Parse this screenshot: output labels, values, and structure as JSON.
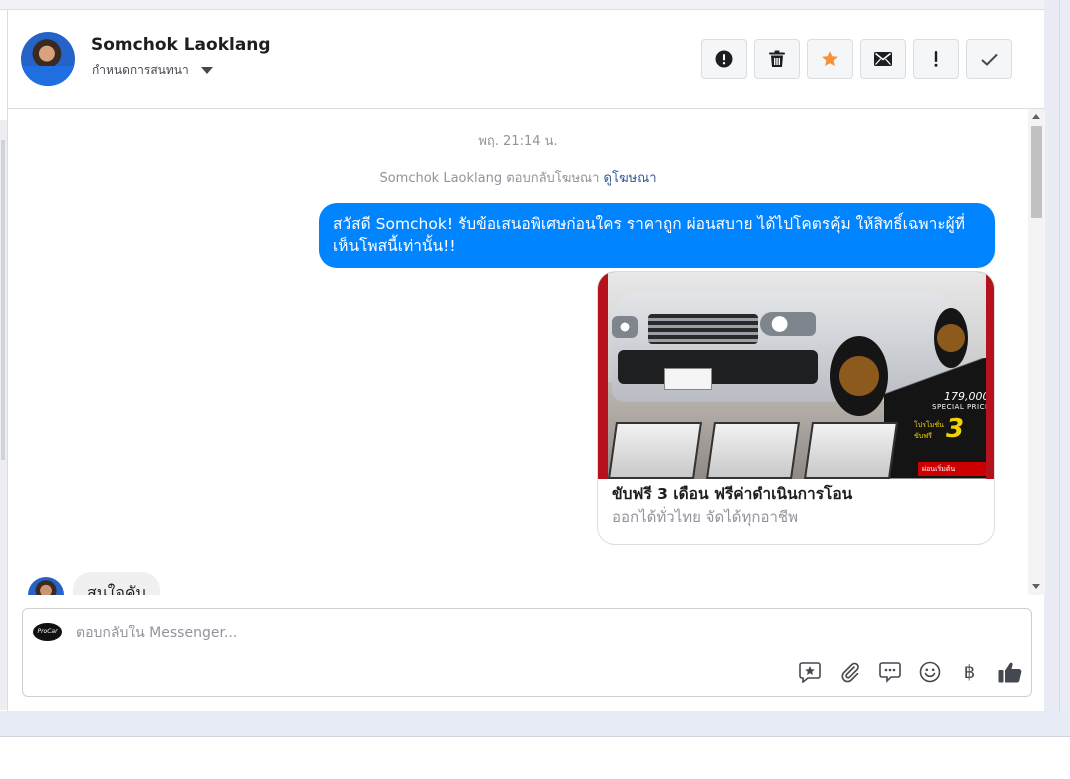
{
  "conversation": {
    "contact_name": "Somchok Laoklang",
    "assign_label": "กำหนดการสนทนา",
    "actions": [
      {
        "name": "spam",
        "icon": "exclamation-circle-icon"
      },
      {
        "name": "delete",
        "icon": "trash-icon"
      },
      {
        "name": "star",
        "icon": "star-icon",
        "color": "#f7923b"
      },
      {
        "name": "mark-unread",
        "icon": "envelope-icon"
      },
      {
        "name": "important",
        "icon": "exclamation-icon"
      },
      {
        "name": "done",
        "icon": "check-icon"
      }
    ]
  },
  "thread": {
    "timestamp": "พฤ. 21:14 น.",
    "replied_prefix": "Somchok Laoklang ตอบกลับโฆษณา",
    "view_ad_link": "ดูโฆษณา",
    "outgoing_message": "สวัสดี Somchok! รับข้อเสนอพิเศษก่อนใคร ราคาถูก ผ่อนสบาย ได้ไปโคตรคุ้ม ให้สิทธิ์เฉพาะผู้ที่เห็นโพสนี้เท่านั้น!!",
    "ad": {
      "title": "ขับฟรี 3 เดือน ฟรีค่าดำเนินการโอน",
      "subtitle": "ออกได้ทั่วไทย จัดได้ทุกอาชีพ",
      "image_price": "179,000",
      "image_special": "SPECIAL PRICE",
      "image_months": "3",
      "image_promo": "โปรโมชั่น ขับฟรี",
      "image_unit": "เดือน",
      "image_tag": "ผ่อนเริ่มต้น"
    },
    "incoming_message": "สนใจคับ"
  },
  "composer": {
    "placeholder": "ตอบกลับใน Messenger...",
    "page_avatar_text": "ProCar",
    "tools": [
      {
        "name": "saved-reply",
        "icon": "star-chat-icon"
      },
      {
        "name": "attach",
        "icon": "paperclip-icon"
      },
      {
        "name": "quick-reply",
        "icon": "chat-bubble-icon"
      },
      {
        "name": "emoji",
        "icon": "smile-icon"
      },
      {
        "name": "payment",
        "icon": "baht-icon",
        "glyph": "฿"
      },
      {
        "name": "like",
        "icon": "thumbs-up-icon"
      }
    ]
  },
  "colors": {
    "outgoing_bubble": "#0084ff",
    "incoming_bubble": "#f1f0f0",
    "link": "#385898",
    "muted_text": "#90949c"
  }
}
